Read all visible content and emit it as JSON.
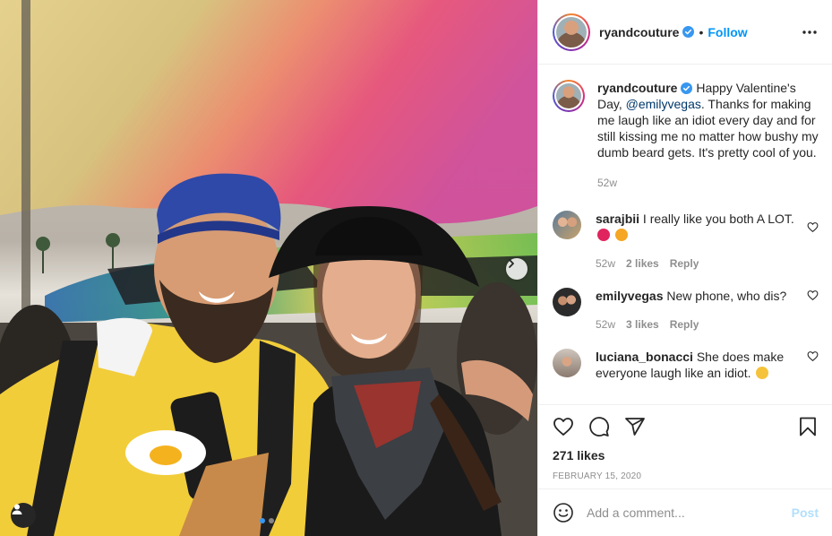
{
  "post": {
    "username": "ryandcouture",
    "follow_label": "Follow",
    "separator": "•",
    "caption_text": "Happy Valentine's Day, ",
    "caption_mention": "@emilyvegas",
    "caption_rest": ". Thanks for making me laugh like an idiot every day and for still kissing me no matter how bushy my dumb beard gets. It's pretty cool of you.",
    "caption_age": "52w"
  },
  "comments": [
    {
      "username": "sarajbii",
      "text": "I really like you both A LOT.",
      "age": "52w",
      "likes": "2 likes",
      "reply": "Reply"
    },
    {
      "username": "emilyvegas",
      "text": "New phone, who dis?",
      "age": "52w",
      "likes": "3 likes",
      "reply": "Reply"
    },
    {
      "username": "luciana_bonacci",
      "text": "She does make everyone laugh like an idiot."
    }
  ],
  "stats": {
    "likes": "271 likes",
    "date": "FEBRUARY 15, 2020"
  },
  "add_comment": {
    "placeholder": "Add a comment...",
    "post_label": "Post"
  },
  "icons": [
    "more-icon",
    "heart-icon",
    "comment-icon",
    "share-icon",
    "bookmark-icon",
    "emoji-icon",
    "verified-icon",
    "chevron-right-icon",
    "user-tag-icon"
  ],
  "colors": {
    "link": "#0095f6",
    "verified": "#3897f0",
    "muted": "#8e8e8e",
    "post_disabled": "#b2dffc"
  },
  "carousel": {
    "slides": 2,
    "active": 1
  }
}
